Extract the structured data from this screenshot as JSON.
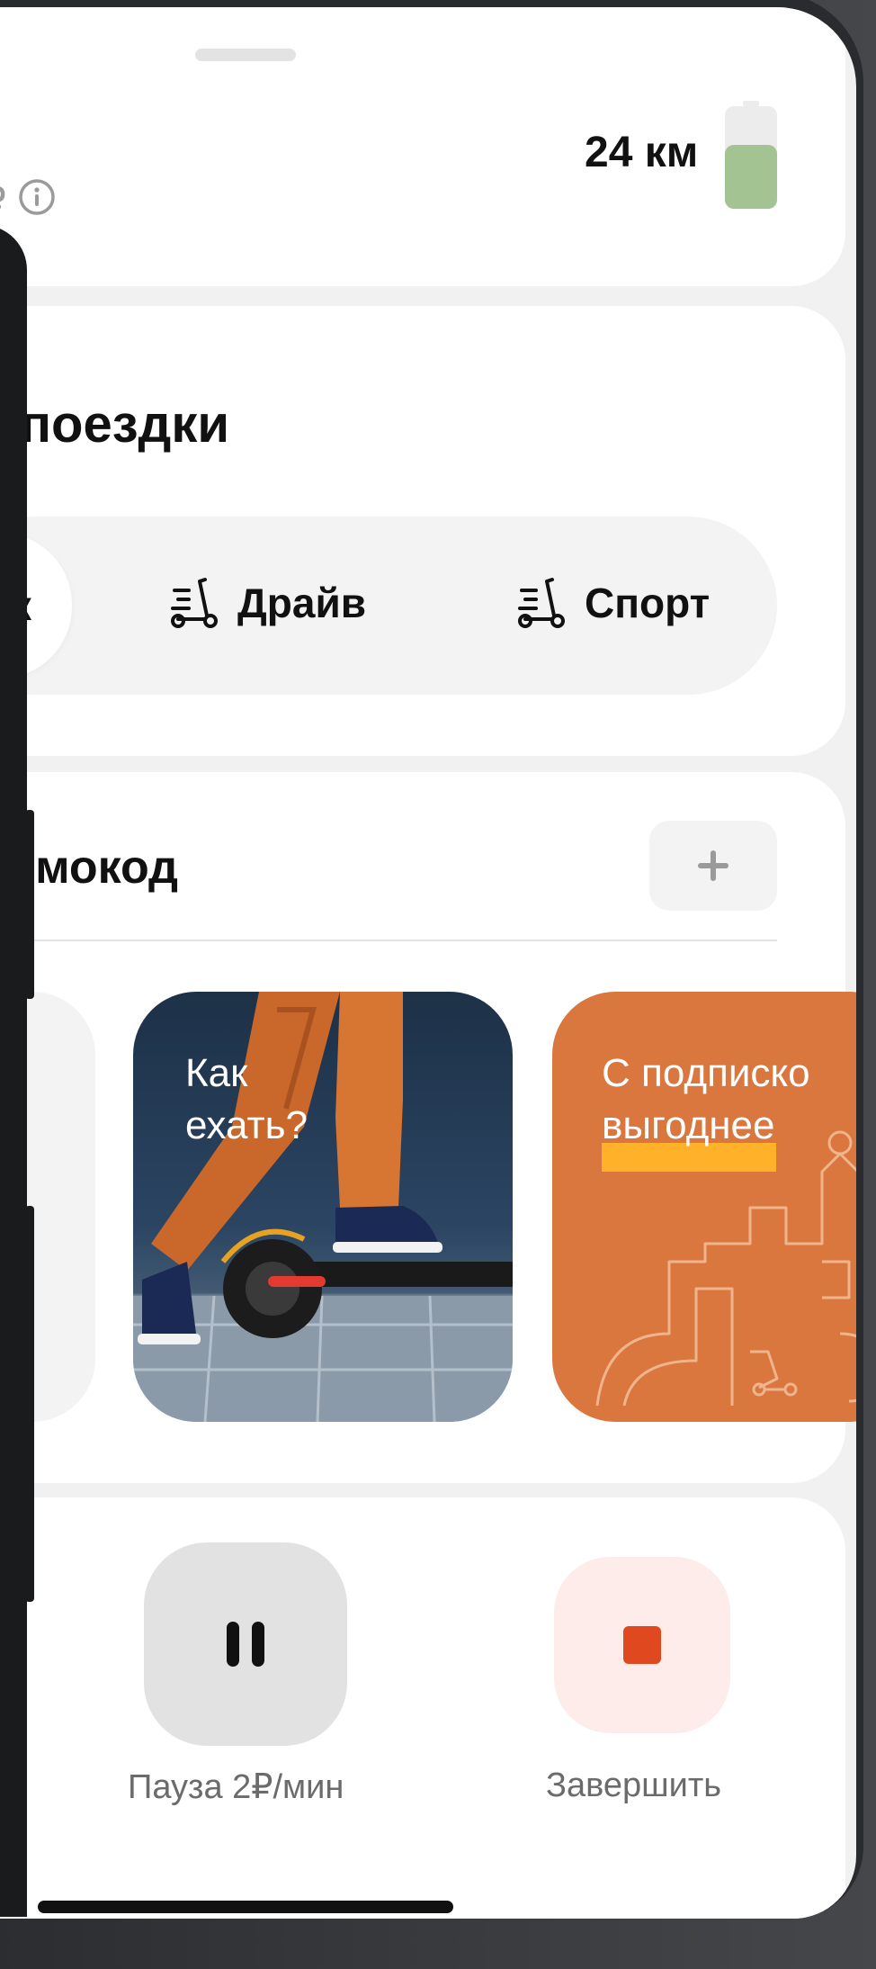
{
  "status": {
    "price_tail": "₽",
    "range": "24 км",
    "battery_level": 0.62,
    "battery_color": "#a3c393"
  },
  "ride_type": {
    "title_visible": "поездки",
    "selected_partial_label": "к",
    "options": [
      {
        "label": "Драйв",
        "icon": "scooter-icon"
      },
      {
        "label": "Спорт",
        "icon": "scooter-icon"
      }
    ]
  },
  "promo": {
    "title_visible": "омокод",
    "add_icon": "plus-icon"
  },
  "stories": [
    {
      "text": "Как\nехать?",
      "background": "#2b4563"
    },
    {
      "text": "С подписко\nвыгоднее",
      "background": "#d9773f",
      "highlight_color": "#ffb12a"
    }
  ],
  "actions": {
    "pause_label": "Пауза 2₽/мин",
    "finish_label": "Завершить",
    "finish_color": "#e0481f"
  }
}
